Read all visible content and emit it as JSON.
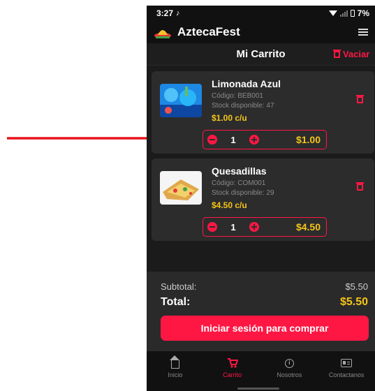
{
  "status": {
    "time": "3:27",
    "battery": "7%"
  },
  "app": {
    "name": "AztecaFest"
  },
  "header": {
    "title": "Mi Carrito",
    "clear_label": "Vaciar"
  },
  "cart": {
    "items": [
      {
        "name": "Limonada Azul",
        "code": "Código: BEB001",
        "stock": "Stock disponible: 47",
        "unit_price": "$1.00 c/u",
        "quantity": "1",
        "total": "$1.00"
      },
      {
        "name": "Quesadillas",
        "code": "Código: COM001",
        "stock": "Stock disponible: 29",
        "unit_price": "$4.50 c/u",
        "quantity": "1",
        "total": "$4.50"
      }
    ]
  },
  "summary": {
    "subtotal_label": "Subtotal:",
    "subtotal_value": "$5.50",
    "total_label": "Total:",
    "total_value": "$5.50",
    "checkout_label": "Iniciar sesión para comprar"
  },
  "nav": {
    "items": [
      {
        "label": "Inicio",
        "icon": "home-icon",
        "active": false
      },
      {
        "label": "Carrito",
        "icon": "cart-icon",
        "active": true
      },
      {
        "label": "Nosotros",
        "icon": "info-icon",
        "active": false
      },
      {
        "label": "Contactanos",
        "icon": "contact-card-icon",
        "active": false
      }
    ]
  },
  "colors": {
    "accent": "#ff1744",
    "price": "#f5c518",
    "background": "#1b1b1b",
    "card": "#2c2c2c"
  }
}
